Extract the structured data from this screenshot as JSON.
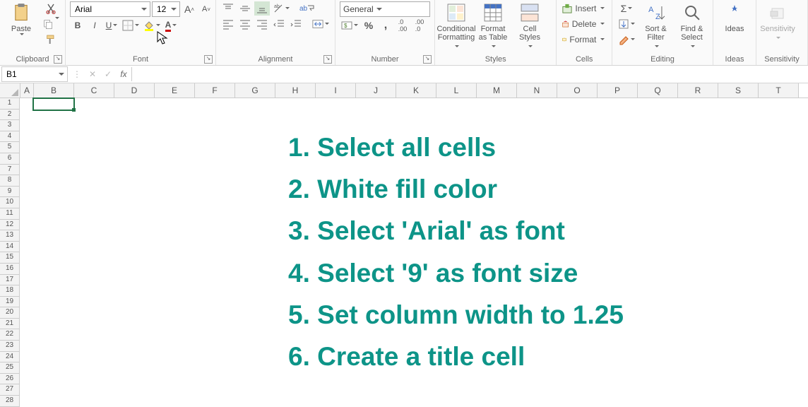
{
  "ribbon": {
    "clipboard": {
      "label": "Clipboard",
      "paste": "Paste"
    },
    "font": {
      "label": "Font",
      "name": "Arial",
      "size": "12",
      "bold": "B",
      "italic": "I",
      "underline": "U"
    },
    "alignment": {
      "label": "Alignment",
      "wrap": "ab"
    },
    "number": {
      "label": "Number",
      "format": "General",
      "pct": "%",
      "comma": ","
    },
    "styles": {
      "label": "Styles",
      "cond": "Conditional Formatting",
      "fat": "Format as Table",
      "cs": "Cell Styles"
    },
    "cells": {
      "label": "Cells",
      "insert": "Insert",
      "delete": "Delete",
      "format": "Format"
    },
    "editing": {
      "label": "Editing",
      "sort": "Sort & Filter",
      "find": "Find & Select"
    },
    "ideas": {
      "label": "Ideas",
      "btn": "Ideas"
    },
    "sens": {
      "label": "Sensitivity",
      "btn": "Sensitivity"
    }
  },
  "nameBox": "B1",
  "columns": [
    "A",
    "B",
    "C",
    "D",
    "E",
    "F",
    "G",
    "H",
    "I",
    "J",
    "K",
    "L",
    "M",
    "N",
    "O",
    "P",
    "Q",
    "R",
    "S",
    "T"
  ],
  "rows": [
    "1",
    "2",
    "3",
    "4",
    "5",
    "6",
    "7",
    "8",
    "9",
    "10",
    "11",
    "12",
    "13",
    "14",
    "15",
    "16",
    "17",
    "18",
    "19",
    "20",
    "21",
    "22",
    "23",
    "24",
    "25",
    "26",
    "27",
    "28"
  ],
  "chart_data": null,
  "overlay": {
    "l1": "1. Select all cells",
    "l2": "2. White fill color",
    "l3": "3. Select 'Arial' as font",
    "l4": "4. Select '9' as font size",
    "l5": "5. Set column width to 1.25",
    "l6": "6. Create a title cell"
  },
  "selectedCell": "B1"
}
